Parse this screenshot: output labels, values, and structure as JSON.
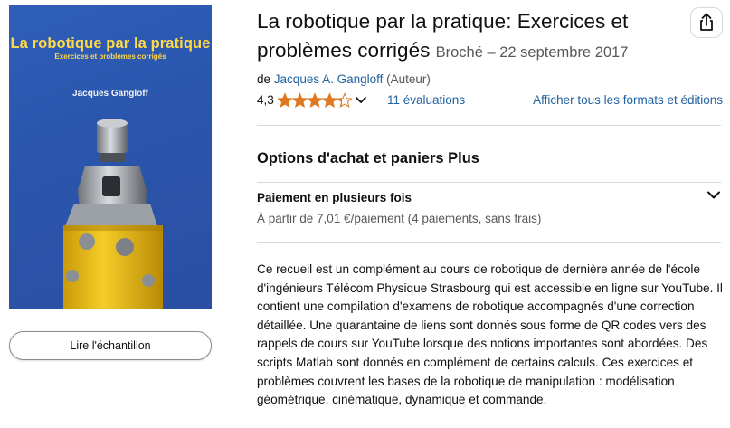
{
  "cover": {
    "title": "La robotique par la pratique",
    "subtitle": "Exercices et problèmes corrigés",
    "author": "Jacques Gangloff"
  },
  "sample_button_label": "Lire l'échantillon",
  "product": {
    "title": "La robotique par la pratique: Exercices et problèmes corrigés",
    "format_date": "Broché – 22 septembre 2017",
    "by_prefix": "de",
    "author": "Jacques A. Gangloff",
    "author_role": "(Auteur)"
  },
  "rating": {
    "value": "4,3",
    "stars_value": 4.3,
    "reviews": "11 évaluations",
    "formats_link": "Afficher tous les formats et éditions"
  },
  "purchase": {
    "heading": "Options d'achat et paniers Plus",
    "installments_title": "Paiement en plusieurs fois",
    "installments_text": "À partir de 7,01 €/paiement (4 paiements, sans frais)"
  },
  "description": "Ce recueil est un complément au cours de robotique de dernière année de l'école d'ingénieurs Télécom Physique Strasbourg qui est accessible en ligne sur YouTube. Il contient une compilation d'examens de robotique accompagnés d'une correction détaillée. Une quarantaine de liens sont donnés sous forme de QR codes vers des rappels de cours sur YouTube lorsque des notions importantes sont abordées. Des scripts Matlab sont donnés en complément de certains calculs. Ces exercices et problèmes couvrent les bases de la robotique de manipulation : modélisation géométrique, cinématique, dynamique et commande.",
  "colors": {
    "link": "#2162a1",
    "star": "#de7921",
    "cover_bg": "#2a56ad",
    "cover_title": "#ffd84a"
  },
  "icons": [
    "share-icon",
    "star-icon",
    "chevron-down-icon"
  ]
}
